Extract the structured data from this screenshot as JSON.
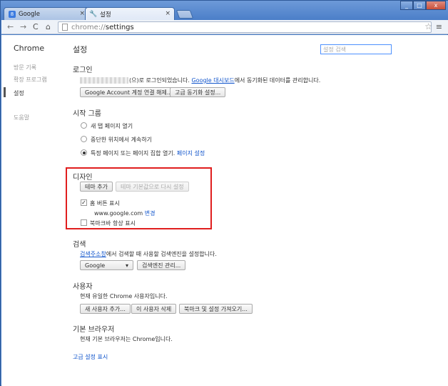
{
  "tabs": [
    {
      "label": "Google",
      "favicon": "google-g-icon"
    },
    {
      "label": "설정",
      "favicon": "wrench-icon"
    }
  ],
  "window_controls": {
    "minimize": "_",
    "maximize": "□",
    "close": "x"
  },
  "address_bar": {
    "scheme": "chrome://",
    "path": "settings"
  },
  "sidebar": {
    "brand": "Chrome",
    "items": [
      {
        "label": "방문 기록"
      },
      {
        "label": "확장 프로그램"
      },
      {
        "label": "설정"
      },
      {
        "label": "도움말"
      }
    ]
  },
  "page": {
    "title": "설정",
    "search_placeholder": "설정 검색"
  },
  "signin": {
    "title": "로그인",
    "text_before": "(으)로 로그인되었습니다. ",
    "dashboard_link": "Google 대시보드",
    "text_after": "에서 동기화된 데이터를 관리합니다.",
    "disconnect_button": "Google Account 계정 연결 해제...",
    "advanced_sync_button": "고급 동기화 설정..."
  },
  "startup": {
    "title": "시작 그룹",
    "options": [
      {
        "label": "새 탭 페이지 열기",
        "selected": false
      },
      {
        "label": "중단한 위치에서 계속하기",
        "selected": false
      },
      {
        "label": "특정 페이지 또는 페이지 집합 열기.",
        "selected": true
      }
    ],
    "set_pages_link": "페이지 설정"
  },
  "appearance": {
    "title": "디자인",
    "get_themes_button": "테마 추가",
    "reset_theme_button": "테마 기본값으로 다시 설정",
    "show_home_button": {
      "label": "홈 버튼 표시",
      "checked": true
    },
    "home_url": "www.google.com",
    "change_link": "변경",
    "bookmarks_bar": {
      "label": "북마크바 항상 표시",
      "checked": false
    }
  },
  "search": {
    "title": "검색",
    "omnibox_link": "검색주소창",
    "text_after": "에서 검색할 때 사용할 검색엔진을 설정합니다.",
    "engine_selected": "Google",
    "manage_button": "검색엔진 관리..."
  },
  "users": {
    "title": "사용자",
    "description": "현재 유일한 Chrome 사용자입니다.",
    "add_button": "새 사용자 추가...",
    "delete_button": "이 사용자 삭제",
    "import_button": "북마크 및 설정 가져오기..."
  },
  "default_browser": {
    "title": "기본 브라우저",
    "description": "현재 기본 브라우저는 Chrome입니다."
  },
  "advanced_link": "고급 설정 표시",
  "colors": {
    "link": "#1155cc",
    "highlight_border": "#e01e1e",
    "frame": "#4a7ec8"
  }
}
